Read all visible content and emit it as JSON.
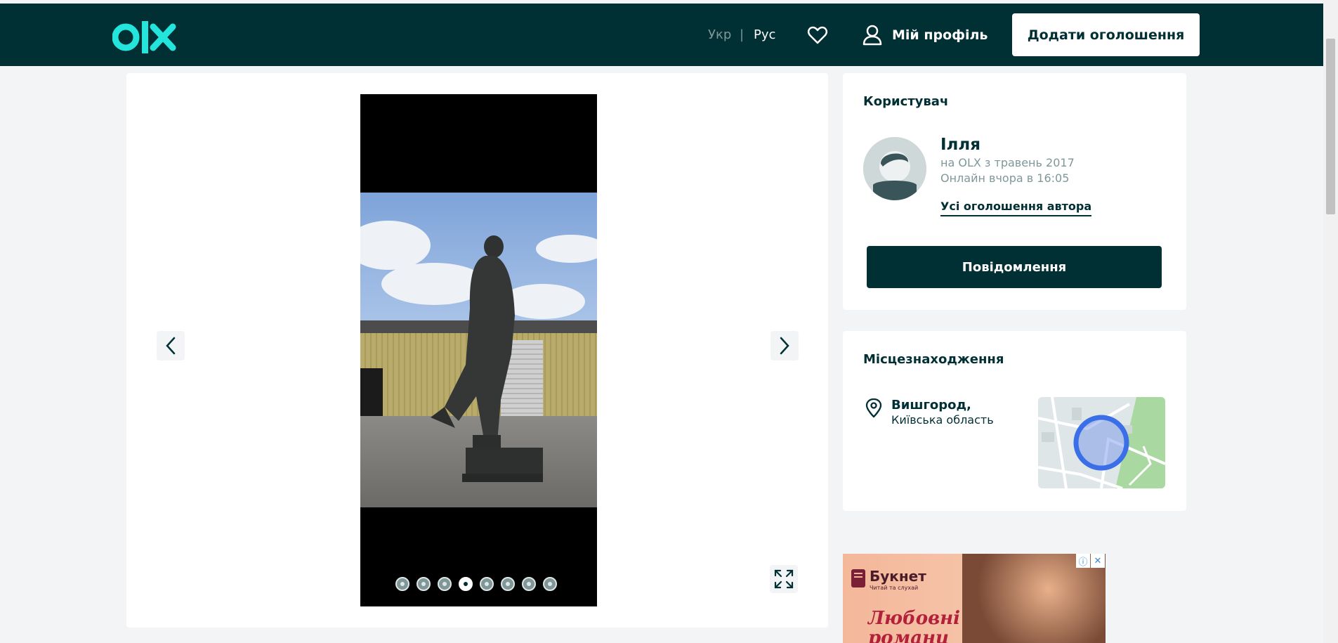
{
  "header": {
    "logo_text": "olx",
    "lang_ukr": "Укр",
    "lang_separator": "|",
    "lang_rus": "Рус",
    "favorites_icon": "heart-icon",
    "profile_label": "Мій профіль",
    "add_ad_label": "Додати оголошення"
  },
  "gallery": {
    "photo_count": 8,
    "active_index": 3,
    "prev_icon": "chevron-left-icon",
    "next_icon": "chevron-right-icon",
    "fullscreen_icon": "fullscreen-icon"
  },
  "user": {
    "section_title": "Користувач",
    "name": "Ілля",
    "since": "на OLX з травень 2017",
    "online": "Онлайн вчора в 16:05",
    "all_ads_link": "Усі оголошення автора",
    "message_button": "Повідомлення"
  },
  "location": {
    "section_title": "Місцезнаходження",
    "city": "Вишгород,",
    "region": "Київська область"
  },
  "ad": {
    "brand": "Букнет",
    "tagline": "Читай та слухай",
    "headline": "Любовні романи"
  },
  "colors": {
    "brand_dark": "#002f34",
    "brand_accent": "#23e5db",
    "page_bg": "#f2f4f5"
  }
}
